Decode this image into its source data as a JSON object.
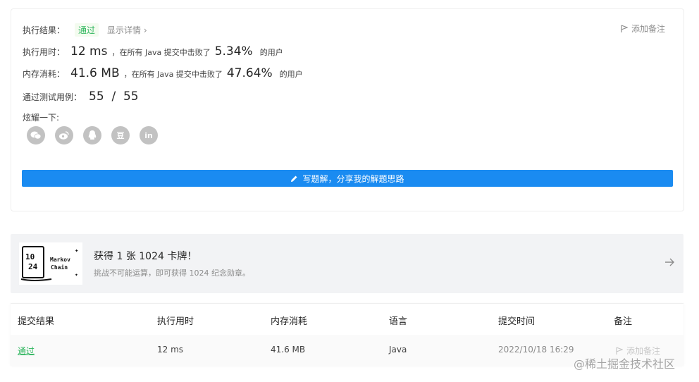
{
  "result": {
    "label": "执行结果：",
    "status": "通过",
    "details_link": "显示详情 ›",
    "add_note": "添加备注"
  },
  "runtime": {
    "label": "执行用时：",
    "value": "12 ms",
    "text_before": "，在所有 Java 提交中击败了",
    "percent": "5.34%",
    "text_after": "的用户"
  },
  "memory": {
    "label": "内存消耗：",
    "value": "41.6 MB",
    "text_before": "，在所有 Java 提交中击败了",
    "percent": "47.64%",
    "text_after": "的用户"
  },
  "tests": {
    "label": "通过测试用例：",
    "value": "55  /  55"
  },
  "share": {
    "label": "炫耀一下:",
    "icons": [
      "wechat-icon",
      "weibo-icon",
      "qq-icon",
      "douban-icon",
      "linkedin-icon"
    ],
    "douban_glyph": "豆",
    "linkedin_glyph": "in"
  },
  "write_button": "写题解，分享我的解题思路",
  "promo": {
    "title": "获得 1 张 1024 卡牌！",
    "subtitle": "挑战不可能运算，即可获得 1024 纪念勋章。",
    "image_line1": "Markov",
    "image_line2": "Chain"
  },
  "table": {
    "headers": [
      "提交结果",
      "执行用时",
      "内存消耗",
      "语言",
      "提交时间",
      "备注"
    ],
    "rows": [
      {
        "result": "通过",
        "runtime": "12 ms",
        "memory": "41.6 MB",
        "language": "Java",
        "time": "2022/10/18 16:29",
        "note": "添加备注"
      }
    ]
  },
  "watermark": "@稀土掘金技术社区",
  "colors": {
    "accent": "#1a8bf1",
    "success": "#2db55d",
    "muted": "#8c8c8c",
    "share_icon_bg": "#c2c2c2"
  }
}
